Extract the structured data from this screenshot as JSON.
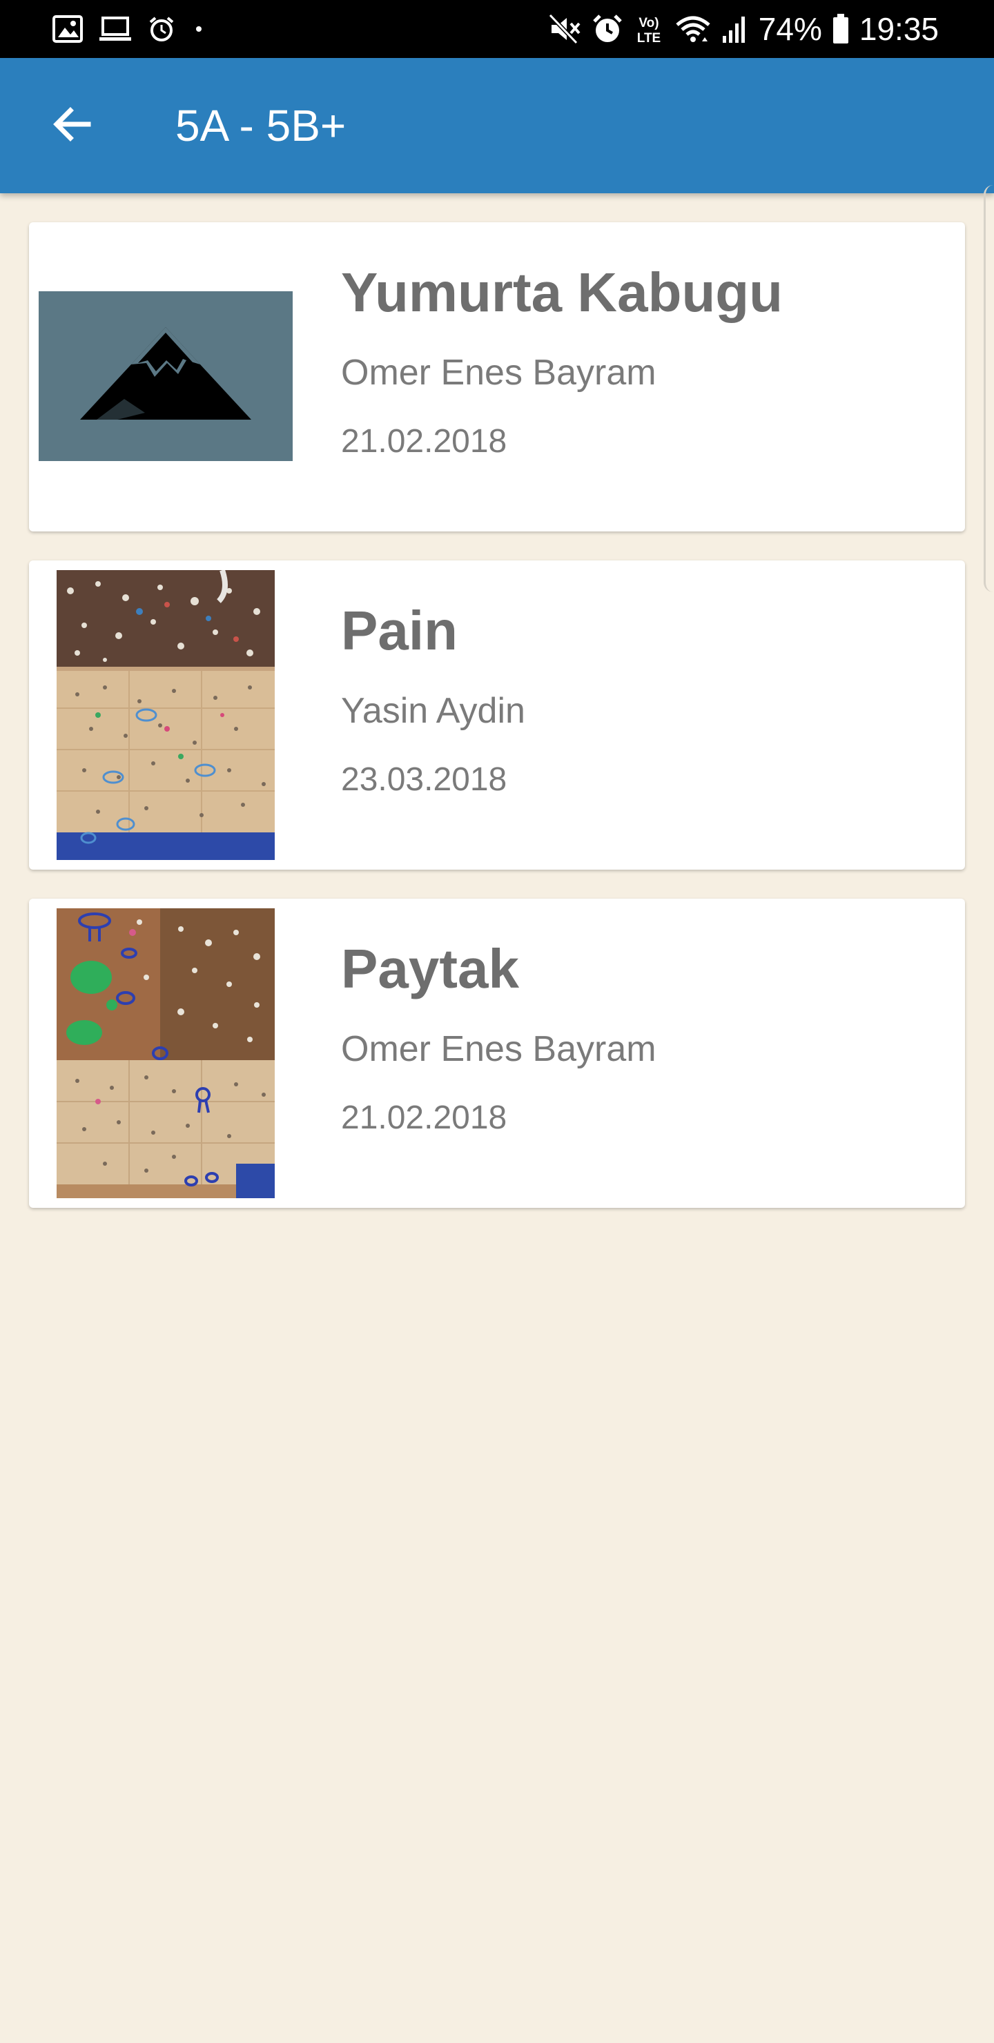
{
  "status_bar": {
    "battery": "74%",
    "time": "19:35",
    "network_label": "VoLTE",
    "left_icons": [
      "gallery-icon",
      "laptop-icon",
      "alarm-icon",
      "dot-icon"
    ],
    "right_icons": [
      "mute-icon",
      "alarm-icon",
      "volte-icon",
      "wifi-icon",
      "signal-icon",
      "battery-icon"
    ]
  },
  "app_bar": {
    "title": "5A - 5B+",
    "back_icon": "arrow-back-icon",
    "color": "#2b7fbd"
  },
  "routes": [
    {
      "name": "Yumurta Kabugu",
      "author": "Omer Enes Bayram",
      "date": "21.02.2018",
      "thumbnail": "mountain-placeholder-icon"
    },
    {
      "name": "Pain",
      "author": "Yasin Aydin",
      "date": "23.03.2018",
      "thumbnail": "climbing-wall-photo"
    },
    {
      "name": "Paytak",
      "author": "Omer Enes Bayram",
      "date": "21.02.2018",
      "thumbnail": "climbing-wall-photo"
    }
  ],
  "colors": {
    "background": "#f6efe2",
    "card": "#ffffff",
    "text_primary": "#6e6e6e",
    "text_secondary": "#7a7a7a"
  }
}
